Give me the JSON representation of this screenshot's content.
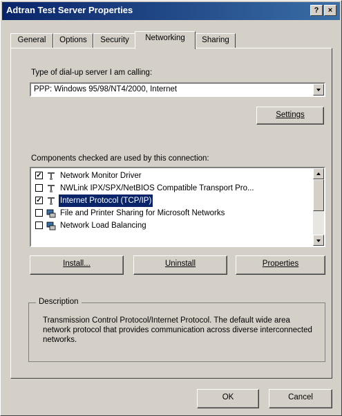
{
  "window": {
    "title": "Adtran Test Server Properties",
    "help": "?",
    "close": "×"
  },
  "tabs": [
    "General",
    "Options",
    "Security",
    "Networking",
    "Sharing"
  ],
  "networking": {
    "server_type_label": "Type of dial-up server I am calling:",
    "server_type_value": "PPP: Windows 95/98/NT4/2000, Internet",
    "settings_button": "Settings",
    "components_label": "Components checked are used by this connection:",
    "components": [
      {
        "label": "Network Monitor Driver",
        "checked": true,
        "icon": "network-protocol-icon"
      },
      {
        "label": "NWLink IPX/SPX/NetBIOS Compatible Transport Pro...",
        "checked": false,
        "icon": "network-protocol-icon"
      },
      {
        "label": "Internet Protocol (TCP/IP)",
        "checked": true,
        "icon": "network-protocol-icon",
        "selected": true
      },
      {
        "label": "File and Printer Sharing for Microsoft Networks",
        "checked": false,
        "icon": "network-service-icon"
      },
      {
        "label": "Network Load Balancing",
        "checked": false,
        "icon": "network-service-icon"
      }
    ],
    "install_button": "Install...",
    "uninstall_button": "Uninstall",
    "properties_button": "Properties",
    "description_title": "Description",
    "description_text": "Transmission Control Protocol/Internet Protocol. The default wide area network protocol that provides communication across diverse interconnected networks."
  },
  "footer": {
    "ok": "OK",
    "cancel": "Cancel"
  },
  "colors": {
    "title_bar": "#0a246a",
    "dialog_bg": "#d4d0c8",
    "selection": "#0a246a"
  }
}
